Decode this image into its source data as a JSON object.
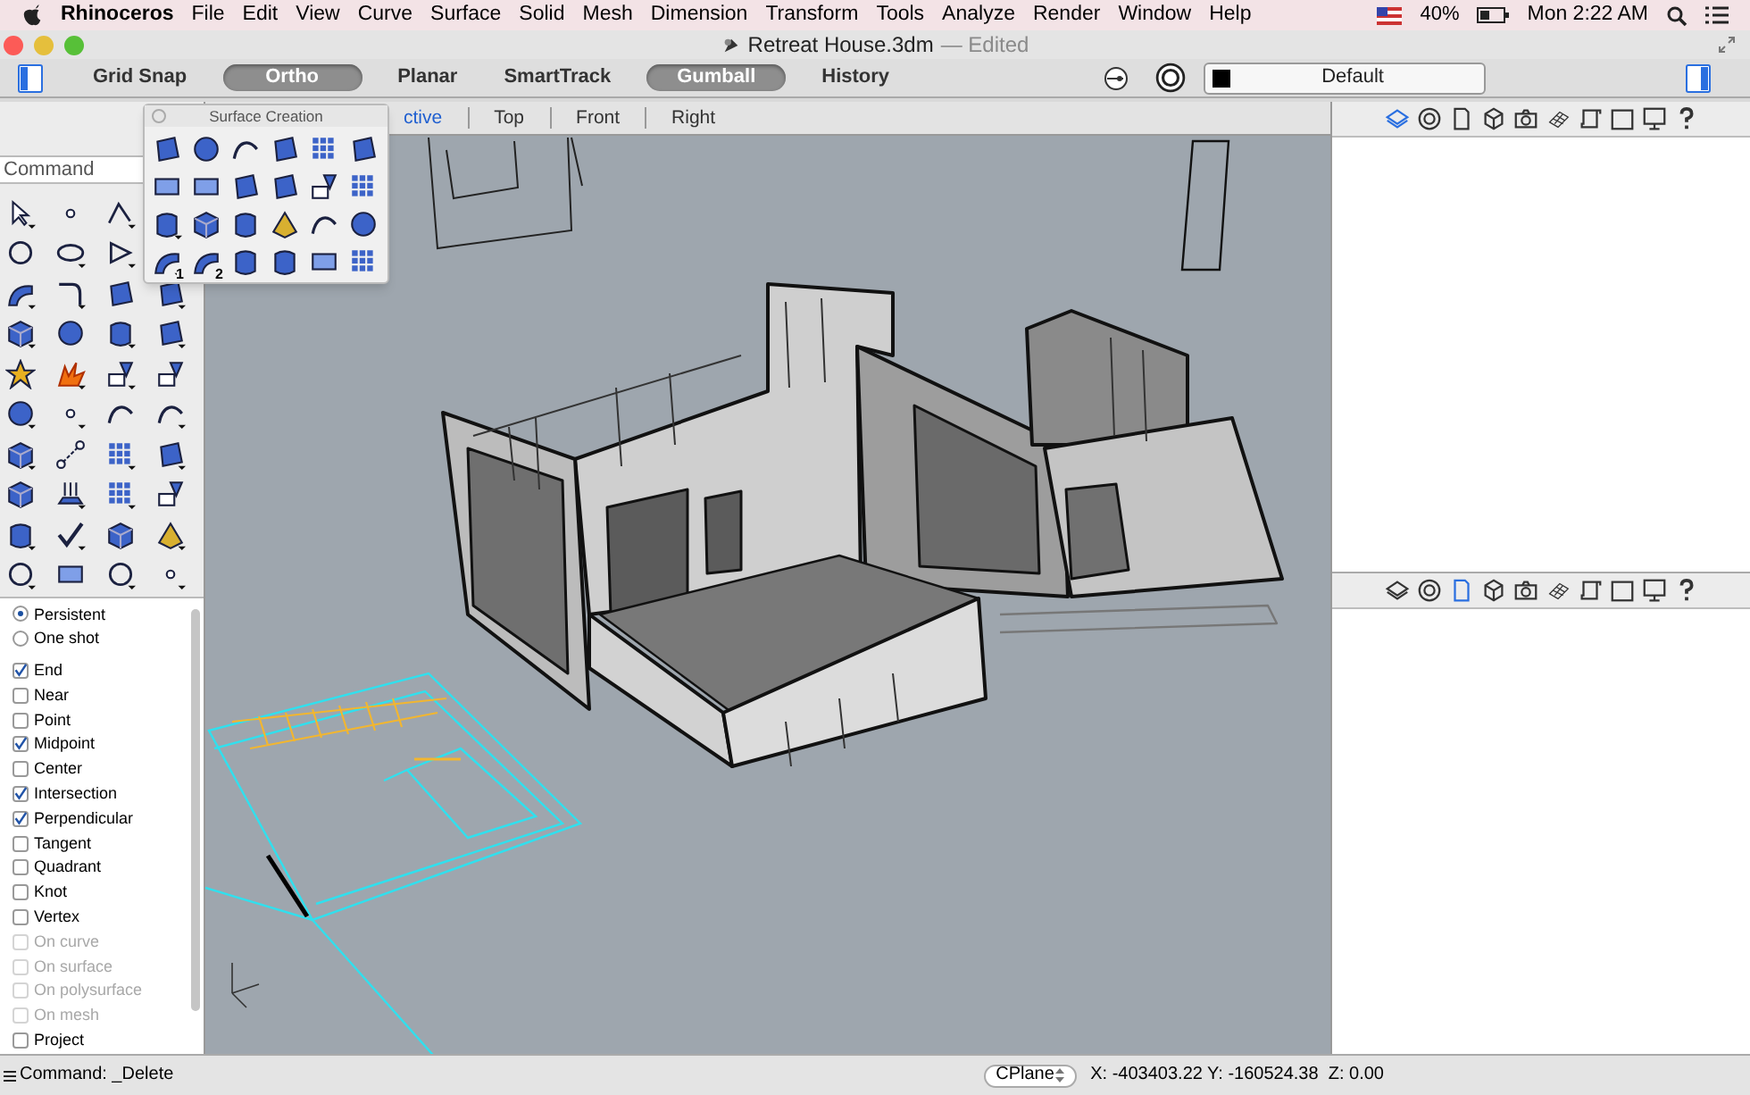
{
  "menu_bar": {
    "app": "Rhinoceros",
    "menus": [
      "File",
      "Edit",
      "View",
      "Curve",
      "Surface",
      "Solid",
      "Mesh",
      "Dimension",
      "Transform",
      "Tools",
      "Analyze",
      "Render",
      "Window",
      "Help"
    ],
    "battery": "40%",
    "clock": "Mon 2:22 AM"
  },
  "window": {
    "title": "Retreat House.3dm",
    "status": "— Edited"
  },
  "toolbar": {
    "toggles": [
      {
        "label": "Grid Snap",
        "on": false
      },
      {
        "label": "Ortho",
        "on": true
      },
      {
        "label": "Planar",
        "on": false
      },
      {
        "label": "SmartTrack",
        "on": false
      },
      {
        "label": "Gumball",
        "on": true
      },
      {
        "label": "History",
        "on": false
      }
    ],
    "layer": "Default"
  },
  "command_field": {
    "placeholder": "Command"
  },
  "palette": {
    "title": "Surface Creation",
    "badges": [
      "1",
      "2"
    ]
  },
  "viewport_tabs": [
    {
      "label": "ctive",
      "selected": true
    },
    {
      "label": "Top",
      "selected": false
    },
    {
      "label": "Front",
      "selected": false
    },
    {
      "label": "Right",
      "selected": false
    }
  ],
  "osnaps": [
    {
      "kind": "radio",
      "label": "Persistent",
      "selected": true
    },
    {
      "kind": "radio",
      "label": "One shot",
      "selected": false
    },
    {
      "kind": "check",
      "label": "End",
      "checked": true,
      "disabled": false
    },
    {
      "kind": "check",
      "label": "Near",
      "checked": false,
      "disabled": false
    },
    {
      "kind": "check",
      "label": "Point",
      "checked": false,
      "disabled": false
    },
    {
      "kind": "check",
      "label": "Midpoint",
      "checked": true,
      "disabled": false
    },
    {
      "kind": "check",
      "label": "Center",
      "checked": false,
      "disabled": false
    },
    {
      "kind": "check",
      "label": "Intersection",
      "checked": true,
      "disabled": false
    },
    {
      "kind": "check",
      "label": "Perpendicular",
      "checked": true,
      "disabled": false
    },
    {
      "kind": "check",
      "label": "Tangent",
      "checked": false,
      "disabled": false
    },
    {
      "kind": "check",
      "label": "Quadrant",
      "checked": false,
      "disabled": false
    },
    {
      "kind": "check",
      "label": "Knot",
      "checked": false,
      "disabled": false
    },
    {
      "kind": "check",
      "label": "Vertex",
      "checked": false,
      "disabled": false
    },
    {
      "kind": "check",
      "label": "On curve",
      "checked": false,
      "disabled": true
    },
    {
      "kind": "check",
      "label": "On surface",
      "checked": false,
      "disabled": true
    },
    {
      "kind": "check",
      "label": "On polysurface",
      "checked": false,
      "disabled": true
    },
    {
      "kind": "check",
      "label": "On mesh",
      "checked": false,
      "disabled": true
    },
    {
      "kind": "check",
      "label": "Project",
      "checked": false,
      "disabled": false
    }
  ],
  "panels": [
    {
      "tabs": [
        {
          "kind": "layers",
          "selected": true
        },
        {
          "kind": "target",
          "selected": false
        },
        {
          "kind": "page",
          "selected": false
        },
        {
          "kind": "cube",
          "selected": false
        },
        {
          "kind": "camera",
          "selected": false
        },
        {
          "kind": "grid",
          "selected": false
        },
        {
          "kind": "scroll",
          "selected": false
        },
        {
          "kind": "square",
          "selected": false
        },
        {
          "kind": "monitor",
          "selected": false
        },
        {
          "kind": "help",
          "selected": false
        }
      ]
    },
    {
      "tabs": [
        {
          "kind": "layers",
          "selected": false
        },
        {
          "kind": "target",
          "selected": false
        },
        {
          "kind": "page",
          "selected": true
        },
        {
          "kind": "cube",
          "selected": false
        },
        {
          "kind": "camera",
          "selected": false
        },
        {
          "kind": "grid",
          "selected": false
        },
        {
          "kind": "scroll",
          "selected": false
        },
        {
          "kind": "square",
          "selected": false
        },
        {
          "kind": "monitor",
          "selected": false
        },
        {
          "kind": "help",
          "selected": false
        }
      ]
    }
  ],
  "status_bar": {
    "command": "Command: _Delete",
    "cplane": "CPlane",
    "coordinates": "X: -403403.22 Y: -160524.38  Z: 0.00"
  }
}
